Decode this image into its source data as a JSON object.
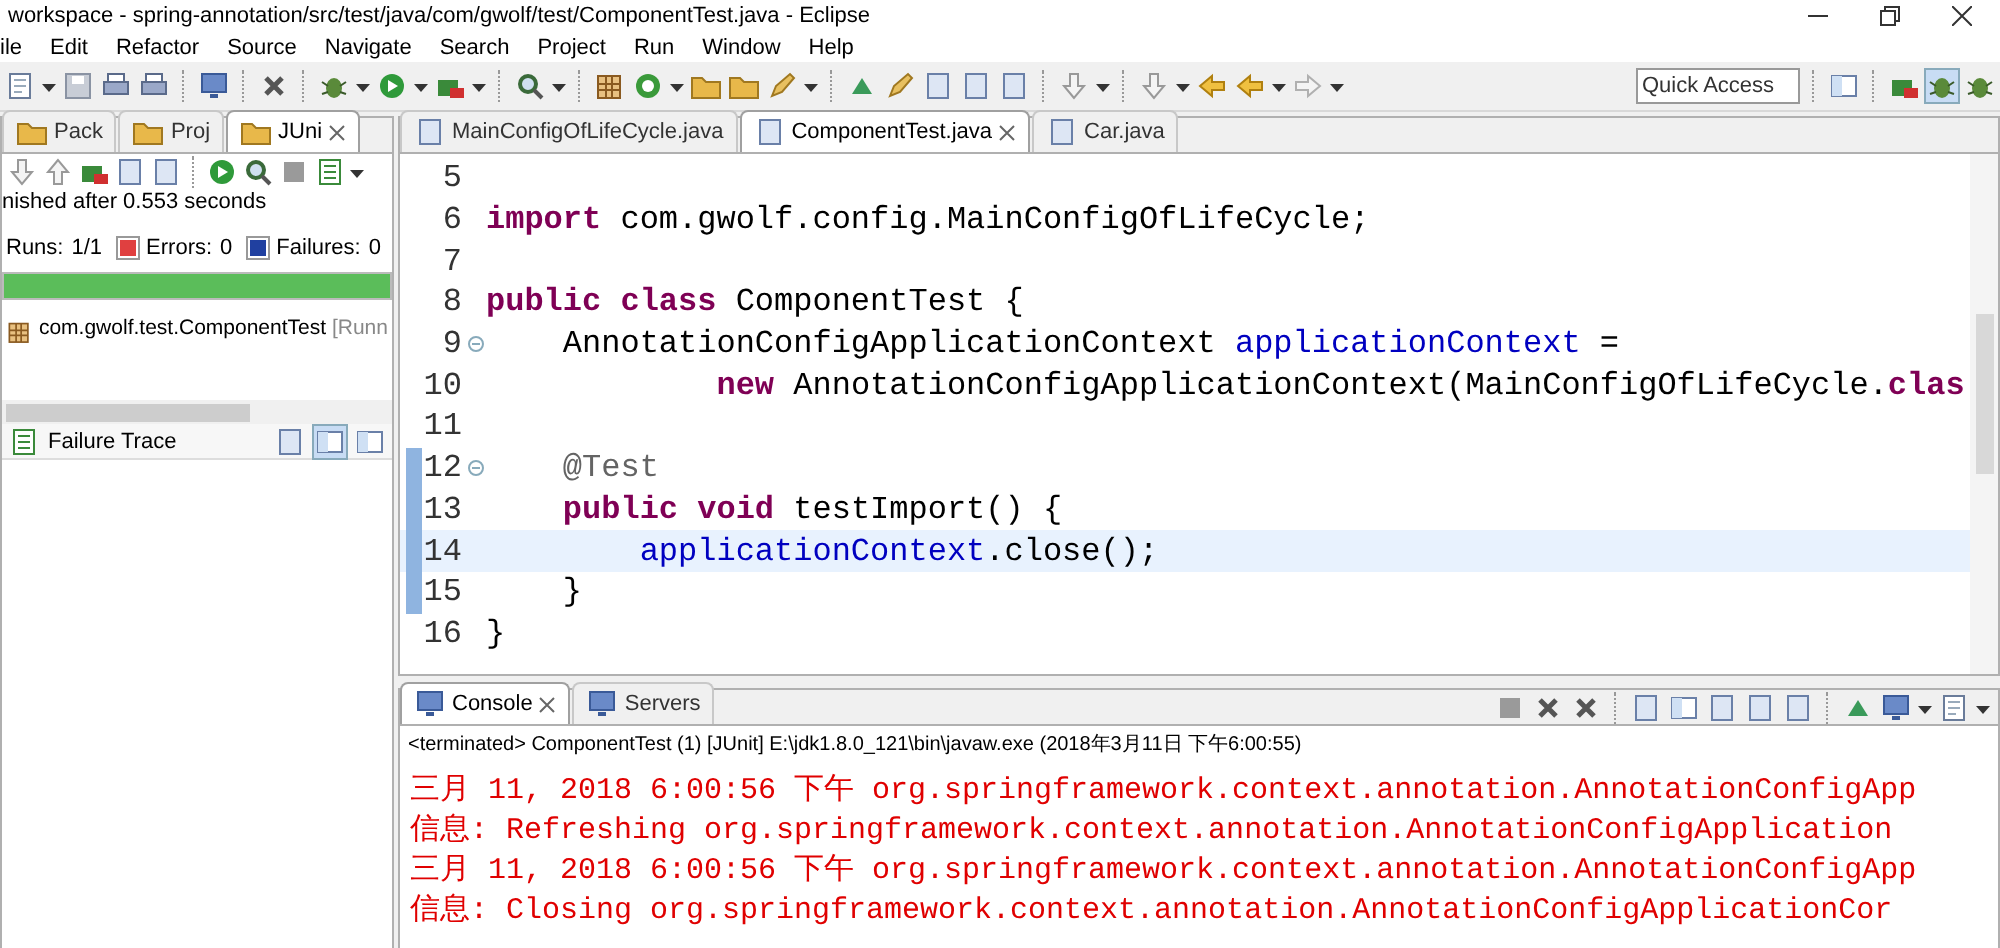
{
  "window": {
    "title": "workspace - spring-annotation/src/test/java/com/gwolf/test/ComponentTest.java - Eclipse"
  },
  "menu": [
    "ile",
    "Edit",
    "Refactor",
    "Source",
    "Navigate",
    "Search",
    "Project",
    "Run",
    "Window",
    "Help"
  ],
  "quick_access": {
    "placeholder": "Quick Access"
  },
  "left_panel": {
    "tabs": [
      {
        "label": "Pack",
        "selected": false
      },
      {
        "label": "Proj",
        "selected": false
      },
      {
        "label": "JUni",
        "selected": true
      }
    ],
    "status": "nished after 0.553 seconds",
    "counts": [
      {
        "label": "Runs:",
        "value": "1/1",
        "kind": "runs"
      },
      {
        "label": "Errors:",
        "value": "0",
        "kind": "errors"
      },
      {
        "label": "Failures:",
        "value": "0",
        "kind": "failures"
      }
    ],
    "progress": {
      "level": 1
    },
    "tree": [
      {
        "label": "com.gwolf.test.ComponentTest",
        "note": "[Runn"
      }
    ],
    "failure_trace": "Failure Trace"
  },
  "editor": {
    "tabs": [
      {
        "label": "MainConfigOfLifeCycle.java",
        "selected": false
      },
      {
        "label": "ComponentTest.java",
        "selected": true
      },
      {
        "label": "Car.java",
        "selected": false
      }
    ],
    "lines": [
      {
        "number": "5",
        "current": false,
        "folding": false,
        "range": false
      },
      {
        "number": "6",
        "current": false,
        "folding": false,
        "range": false,
        "tokens": [
          {
            "text": "import",
            "kind": "keyword"
          },
          {
            "text": " com.gwolf.config.MainConfigOfLifeCycle;",
            "kind": "plain"
          }
        ]
      },
      {
        "number": "7",
        "current": false,
        "folding": false,
        "range": false
      },
      {
        "number": "8",
        "current": false,
        "folding": false,
        "range": false,
        "tokens": [
          {
            "text": "public class",
            "kind": "keyword"
          },
          {
            "text": " ComponentTest {",
            "kind": "plain"
          }
        ]
      },
      {
        "number": "9",
        "current": false,
        "folding": true,
        "range": false,
        "tokens": [
          {
            "text": "    AnnotationConfigApplicationContext ",
            "kind": "plain"
          },
          {
            "text": "applicationContext",
            "kind": "field"
          },
          {
            "text": " =",
            "kind": "plain"
          }
        ]
      },
      {
        "number": "10",
        "current": false,
        "folding": false,
        "range": false,
        "tokens": [
          {
            "text": "            new",
            "kind": "keyword"
          },
          {
            "text": " AnnotationConfigApplicationContext(MainConfigOfLifeCycle.",
            "kind": "plain"
          },
          {
            "text": "clas",
            "kind": "keyword"
          }
        ]
      },
      {
        "number": "11",
        "current": false,
        "folding": false,
        "range": false
      },
      {
        "number": "12",
        "current": false,
        "folding": true,
        "range": true,
        "tokens": [
          {
            "text": "    @Test",
            "kind": "annotation"
          }
        ]
      },
      {
        "number": "13",
        "current": false,
        "folding": false,
        "range": true,
        "tokens": [
          {
            "text": "    public void",
            "kind": "keyword"
          },
          {
            "text": " testImport() {",
            "kind": "plain"
          }
        ]
      },
      {
        "number": "14",
        "current": true,
        "folding": false,
        "range": true,
        "tokens": [
          {
            "text": "        applicationContext",
            "kind": "field"
          },
          {
            "text": ".close();",
            "kind": "plain"
          }
        ]
      },
      {
        "number": "15",
        "current": false,
        "folding": false,
        "range": true,
        "tokens": [
          {
            "text": "    }",
            "kind": "plain"
          }
        ]
      },
      {
        "number": "16",
        "current": false,
        "folding": false,
        "range": false,
        "tokens": [
          {
            "text": "}",
            "kind": "plain"
          }
        ]
      }
    ]
  },
  "console": {
    "tabs": [
      {
        "label": "Console",
        "selected": true
      },
      {
        "label": "Servers",
        "selected": false
      }
    ],
    "description": "<terminated> ComponentTest (1) [JUnit] E:\\jdk1.8.0_121\\bin\\javaw.exe (2018年3月11日 下午6:00:55)",
    "lines": [
      "三月 11, 2018 6:00:56 下午 org.springframework.context.annotation.AnnotationConfigApp",
      "信息: Refreshing org.springframework.context.annotation.AnnotationConfigApplication",
      "三月 11, 2018 6:00:56 下午 org.springframework.context.annotation.AnnotationConfigApp",
      "信息: Closing org.springframework.context.annotation.AnnotationConfigApplicationCor"
    ]
  }
}
